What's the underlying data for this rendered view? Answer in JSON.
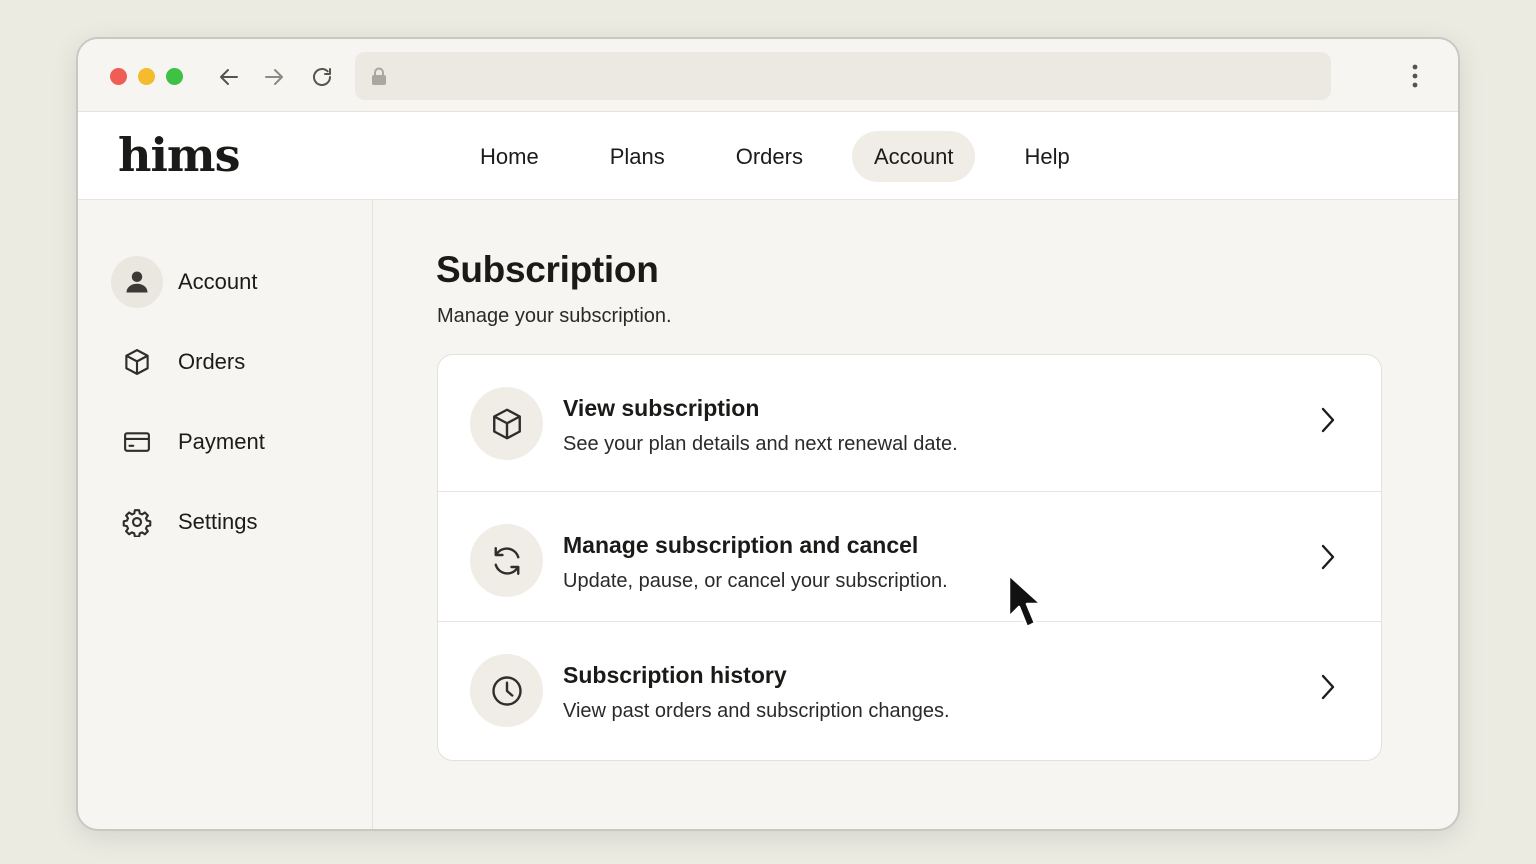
{
  "browser": {
    "address": {
      "value": "",
      "placeholder": ""
    },
    "icons": [
      "back-arrow-icon",
      "forward-arrow-icon",
      "reload-icon",
      "lock-icon",
      "more-vertical-icon"
    ]
  },
  "header": {
    "logo": "hims",
    "nav": [
      {
        "label": "Home",
        "active": false
      },
      {
        "label": "Plans",
        "active": false
      },
      {
        "label": "Orders",
        "active": false
      },
      {
        "label": "Account",
        "active": true
      },
      {
        "label": "Help",
        "active": false
      }
    ]
  },
  "sidebar": {
    "items": [
      {
        "label": "Account",
        "icon": "person-icon",
        "active": true
      },
      {
        "label": "Orders",
        "icon": "box-icon",
        "active": false
      },
      {
        "label": "Payment",
        "icon": "credit-card-icon",
        "active": false
      },
      {
        "label": "Settings",
        "icon": "gear-icon",
        "active": false
      }
    ]
  },
  "main": {
    "title": "Subscription",
    "subtitle": "Manage your subscription.",
    "rows": [
      {
        "title": "View subscription",
        "description": "See your plan details and next renewal date.",
        "icon": "box-icon"
      },
      {
        "title": "Manage subscription and cancel",
        "description": "Update, pause, or cancel your subscription.",
        "icon": "refresh-icon"
      },
      {
        "title": "Subscription history",
        "description": "View past orders and subscription changes.",
        "icon": "clock-icon"
      }
    ]
  },
  "colors": {
    "page_background": "#ecebe2",
    "window_background": "#f6f5f1",
    "card_background": "#ffffff",
    "active_pill": "#efede6",
    "text": "#1c1c1a",
    "traffic_red": "#ef5d55",
    "traffic_yellow": "#f4bb2c",
    "traffic_green": "#3fc145"
  }
}
